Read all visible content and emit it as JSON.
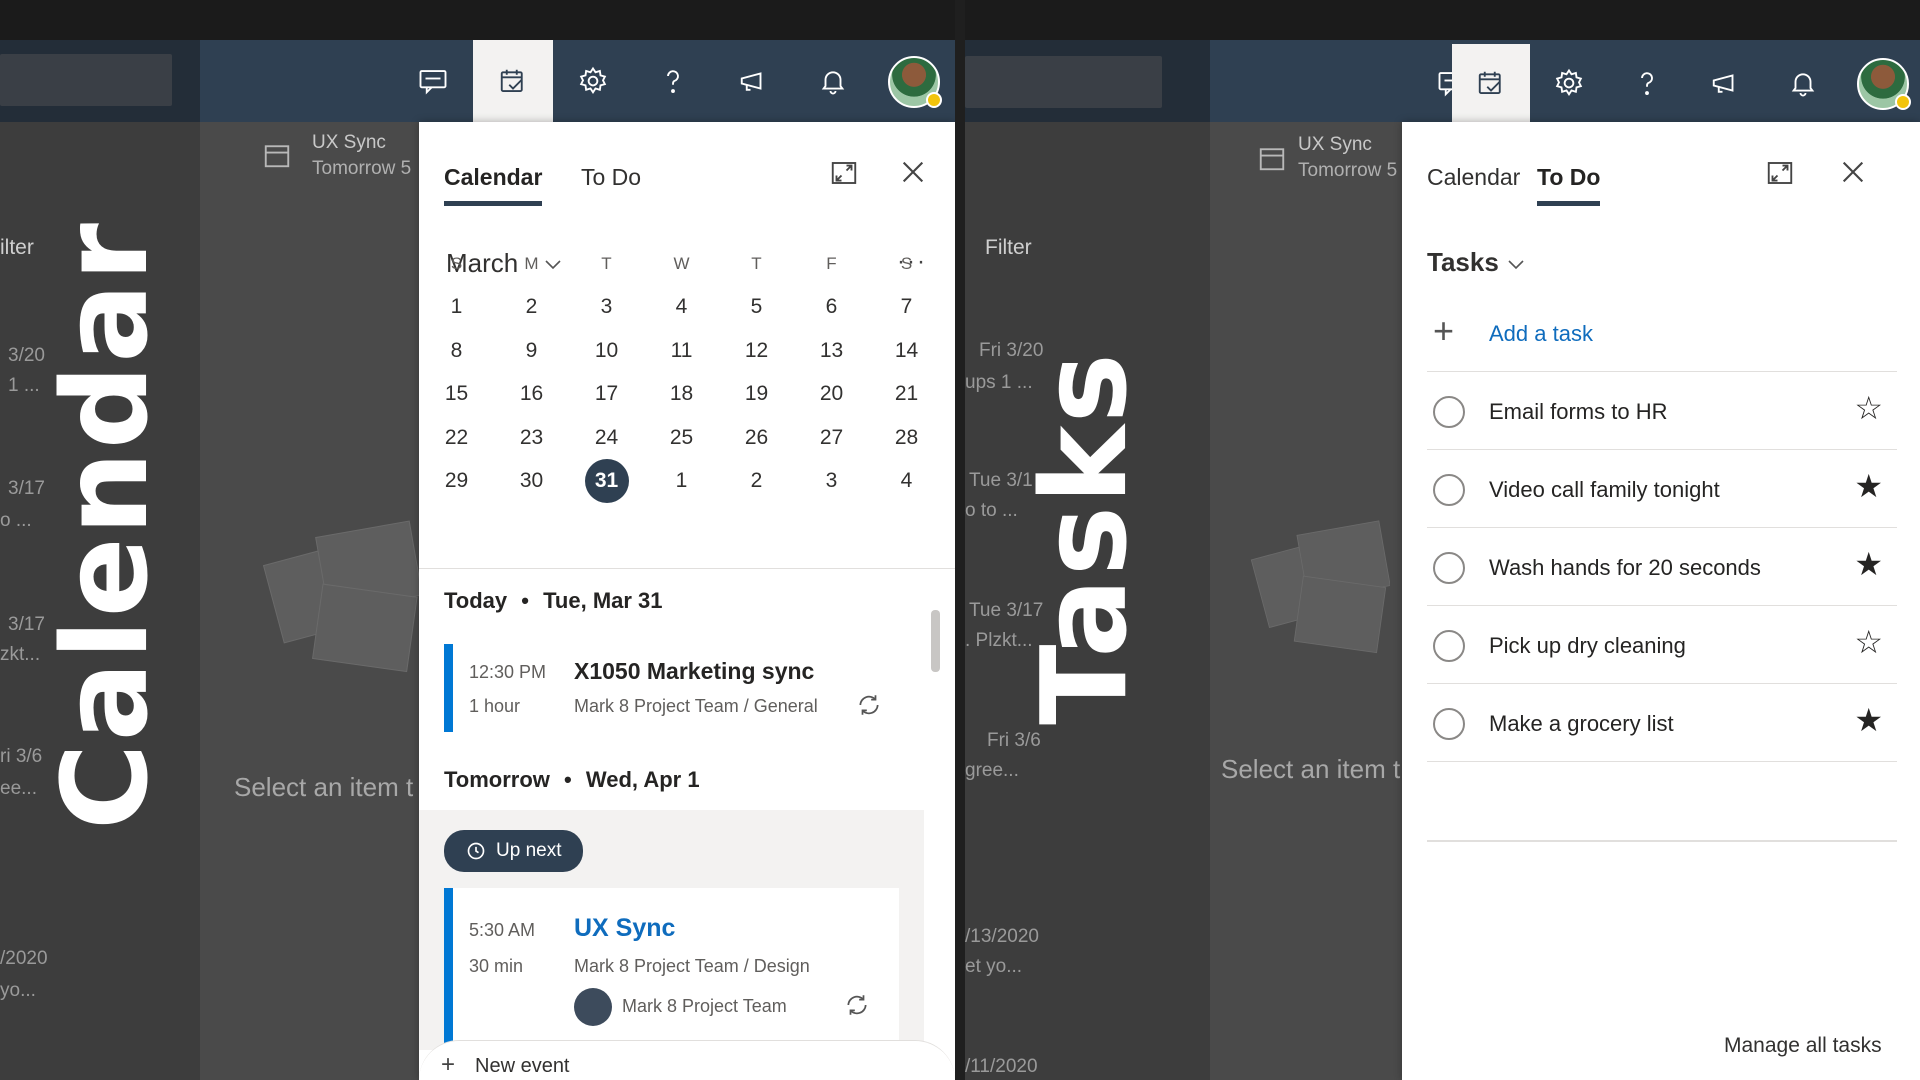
{
  "left_panel": {
    "overlay_word": "Calendar",
    "sidebar_fragments": [
      "ilter",
      "3/20",
      "1 ...",
      "3/17",
      "o ...",
      "3/17",
      "zkt...",
      "ri 3/6",
      "ee...",
      "/2020",
      "yo..."
    ],
    "reminder": {
      "title": "UX Sync",
      "subtitle": "Tomorrow 5"
    },
    "placeholder": "Select an item t",
    "flyout": {
      "tabs": [
        "Calendar",
        "To Do"
      ],
      "selected_tab": "Calendar",
      "month": "March",
      "weekday_headers": [
        "S",
        "M",
        "T",
        "W",
        "T",
        "F",
        "S"
      ],
      "days": [
        "1",
        "2",
        "3",
        "4",
        "5",
        "6",
        "7",
        "8",
        "9",
        "10",
        "11",
        "12",
        "13",
        "14",
        "15",
        "16",
        "17",
        "18",
        "19",
        "20",
        "21",
        "22",
        "23",
        "24",
        "25",
        "26",
        "27",
        "28",
        "29",
        "30",
        "31",
        "1",
        "2",
        "3",
        "4"
      ],
      "today": "31",
      "today_header": {
        "label": "Today",
        "date": "Tue, Mar 31"
      },
      "event1": {
        "time": "12:30 PM",
        "duration": "1 hour",
        "title": "X1050 Marketing sync",
        "location": "Mark 8 Project Team / General"
      },
      "tomorrow_header": {
        "label": "Tomorrow",
        "date": "Wed, Apr 1"
      },
      "up_next": "Up next",
      "event2": {
        "time": "5:30 AM",
        "duration": "30 min",
        "title": "UX Sync",
        "location": "Mark 8 Project Team / Design",
        "organizer": "Mark 8 Project Team"
      },
      "new_event": "New event"
    }
  },
  "right_panel": {
    "overlay_word": "Tasks",
    "sidebar_fragments": [
      "Filter",
      "Fri 3/20",
      "ups 1 ...",
      "Tue 3/1",
      "o to ...",
      "Tue 3/17",
      ". Plzkt...",
      "Fri 3/6",
      "gree...",
      "/13/2020",
      "et yo...",
      "/11/2020"
    ],
    "reminder": {
      "title": "UX Sync",
      "subtitle": "Tomorrow 5"
    },
    "placeholder": "Select an item t",
    "flyout": {
      "tabs": [
        "Calendar",
        "To Do"
      ],
      "selected_tab": "To Do",
      "list_title": "Tasks",
      "add_task": "Add a task",
      "tasks": [
        {
          "title": "Email forms to HR",
          "important": false
        },
        {
          "title": "Video call family tonight",
          "important": true
        },
        {
          "title": "Wash hands for 20 seconds",
          "important": true
        },
        {
          "title": "Pick up dry cleaning",
          "important": false
        },
        {
          "title": "Make a grocery list",
          "important": true
        }
      ],
      "manage_link": "Manage all tasks"
    }
  },
  "colors": {
    "nav": "#2f4052",
    "accent": "#0078d4",
    "event_link": "#0f6cbd"
  },
  "icons": [
    "chat-icon",
    "todo-icon",
    "gear-icon",
    "help-icon",
    "megaphone-icon",
    "bell-icon",
    "expand-icon",
    "close-icon",
    "chevron-down-icon",
    "more-icon",
    "sync-icon",
    "clock-icon",
    "plus-icon",
    "star-icon",
    "calendar-icon"
  ]
}
